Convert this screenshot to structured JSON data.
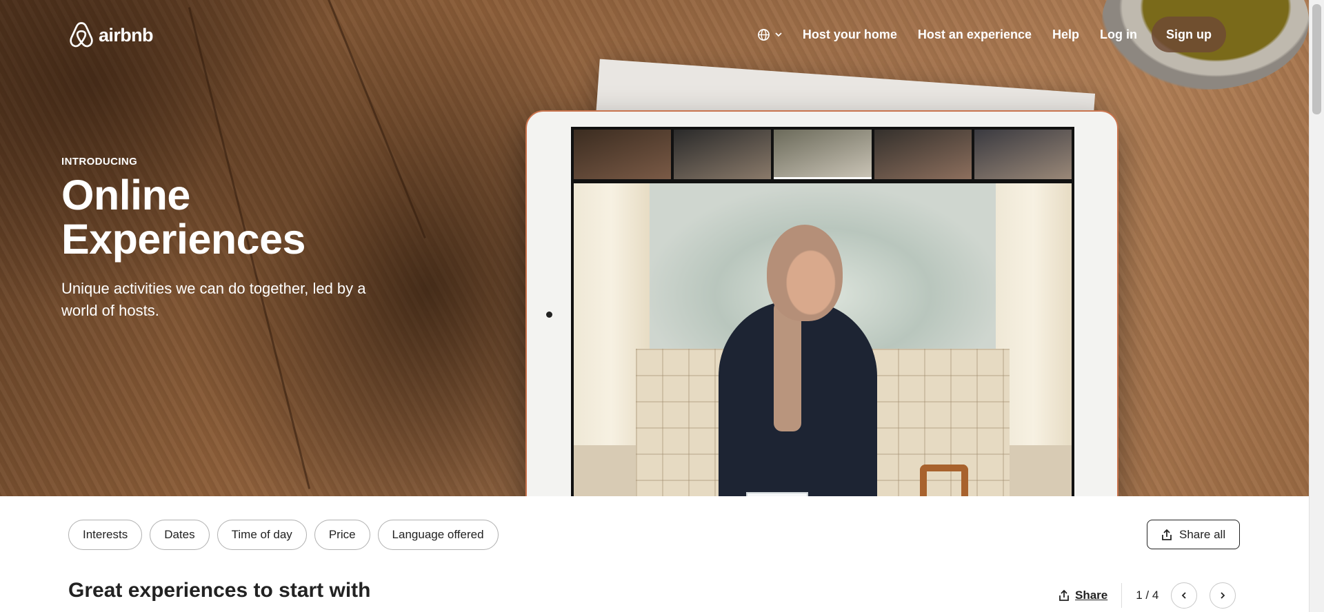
{
  "header": {
    "logo_text": "airbnb",
    "nav": {
      "host_home": "Host your home",
      "host_experience": "Host an experience",
      "help": "Help",
      "login": "Log in",
      "signup": "Sign up"
    }
  },
  "hero": {
    "eyebrow": "INTRODUCING",
    "title": "Online Experiences",
    "subtitle": "Unique activities we can do together, led by a world of hosts."
  },
  "filters": [
    "Interests",
    "Dates",
    "Time of day",
    "Price",
    "Language offered"
  ],
  "share_all_label": "Share all",
  "section": {
    "title": "Great experiences to start with",
    "share_label": "Share",
    "pager": "1 / 4"
  },
  "colors": {
    "signup_bg": "#6e4a34",
    "text_dark": "#222222",
    "pill_border": "#b0b0b0"
  },
  "icons": [
    "airbnb-logo-icon",
    "globe-icon",
    "chevron-down-icon",
    "share-icon",
    "chevron-left-icon",
    "chevron-right-icon"
  ]
}
